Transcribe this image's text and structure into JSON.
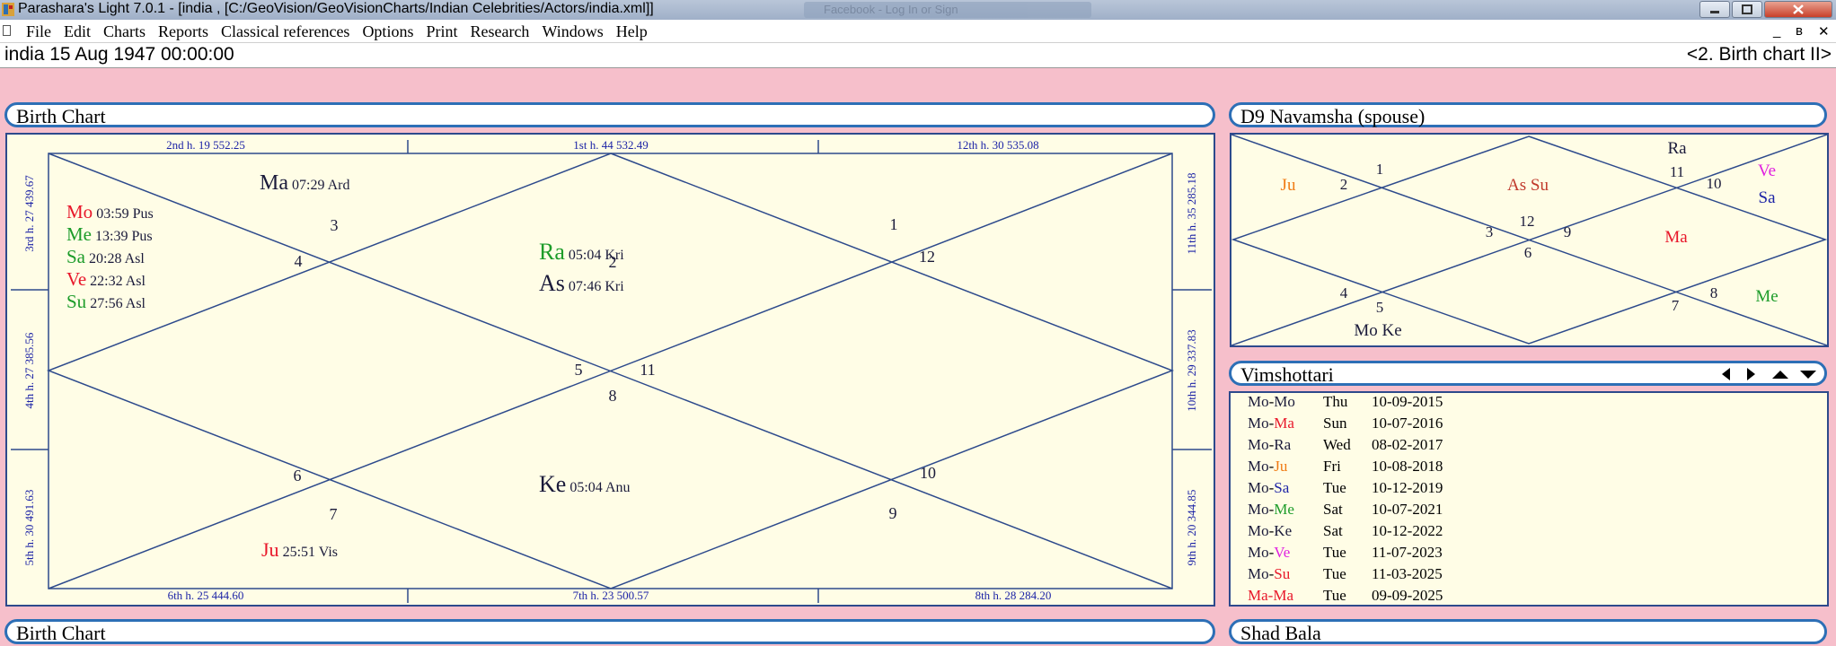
{
  "window": {
    "title": "Parashara's Light 7.0.1 - [india ,  [C:/GeoVision/GeoVisionCharts/Indian Celebrities/Actors/india.xml]]",
    "background_tab": "Facebook - Log In or Sign"
  },
  "menu": [
    "File",
    "Edit",
    "Charts",
    "Reports",
    "Classical references",
    "Options",
    "Print",
    "Research",
    "Windows",
    "Help"
  ],
  "mdi_controls": {
    "minimize": "_",
    "restore": "ʙ",
    "close": "✕"
  },
  "infobar": {
    "left": "india   15 Aug 1947 00:00:00",
    "right": "<2. Birth chart II>"
  },
  "panels": {
    "birth_chart_title": "Birth Chart",
    "d9_title": "D9 Navamsha  (spouse)",
    "vimshottari_title": "Vimshottari",
    "bottom_left_title": "Birth Chart",
    "bottom_right_title": "Shad Bala"
  },
  "colors": {
    "accent": "#2d6fb6",
    "chart_line": "#2d4a8c",
    "chart_bg": "#fffde6",
    "red": "#e8172a",
    "green": "#1d9c2a",
    "blue": "#1c23a6",
    "orange": "#f07a12",
    "magenta": "#e020e0",
    "dark": "#1a1a3a"
  },
  "birth_chart": {
    "houses_top": [
      "2nd h.  19  552.25",
      "1st h.  44  532.49",
      "12th h.  30  535.08"
    ],
    "houses_bottom": [
      "6th h.  25  444.60",
      "7th h.  23  500.57",
      "8th h.  28  284.20"
    ],
    "houses_left": [
      "3rd h.  27  439.67",
      "4th h.  27  385.56",
      "5th h.  30  491.63"
    ],
    "houses_right": [
      "11th h.  35  285.18",
      "10th h.  29  337.83",
      "9th h.  20  344.85"
    ],
    "sign_numbers": {
      "h1": "2",
      "h2": "1",
      "h3": "12",
      "h4": "11",
      "h5": "10",
      "h6": "9",
      "h7": "8",
      "h8": "7",
      "h9": "6",
      "h10": "5",
      "h11": "4",
      "h12": "3"
    },
    "planets": [
      {
        "planet": "Ma",
        "deg": "07:29",
        "nak": "Ard",
        "color": "dark"
      },
      {
        "planet": "Mo",
        "deg": "03:59",
        "nak": "Pus",
        "color": "red"
      },
      {
        "planet": "Me",
        "deg": "13:39",
        "nak": "Pus",
        "color": "green"
      },
      {
        "planet": "Sa",
        "deg": "20:28",
        "nak": "Asl",
        "color": "green"
      },
      {
        "planet": "Ve",
        "deg": "22:32",
        "nak": "Asl",
        "color": "red"
      },
      {
        "planet": "Su",
        "deg": "27:56",
        "nak": "Asl",
        "color": "green"
      },
      {
        "planet": "Ra",
        "deg": "05:04",
        "nak": "Kri",
        "color": "green"
      },
      {
        "planet": "As",
        "deg": "07:46",
        "nak": "Kri",
        "color": "dark"
      },
      {
        "planet": "Ke",
        "deg": "05:04",
        "nak": "Anu",
        "color": "dark"
      },
      {
        "planet": "Ju",
        "deg": "25:51",
        "nak": "Vis",
        "color": "red"
      }
    ]
  },
  "d9": {
    "numbers": {
      "n1": "1",
      "n2": "2",
      "n3": "3",
      "n4": "4",
      "n5": "5",
      "n6": "6",
      "n7": "7",
      "n8": "8",
      "n9": "9",
      "n10": "10",
      "n11": "11",
      "n12": "12"
    },
    "planets": {
      "ju": "Ju",
      "as_su": "As Su",
      "ra": "Ra",
      "ve": "Ve",
      "sa": "Sa",
      "ma": "Ma",
      "me": "Me",
      "mo_ke": "Mo Ke"
    }
  },
  "vimshottari": {
    "rows": [
      {
        "a": "Mo",
        "b": "Mo",
        "day": "Thu",
        "date": "10-09-2015",
        "a_color": "dark",
        "b_color": "dark"
      },
      {
        "a": "Mo",
        "b": "Ma",
        "day": "Sun",
        "date": "10-07-2016",
        "a_color": "dark",
        "b_color": "red"
      },
      {
        "a": "Mo",
        "b": "Ra",
        "day": "Wed",
        "date": "08-02-2017",
        "a_color": "dark",
        "b_color": "dark"
      },
      {
        "a": "Mo",
        "b": "Ju",
        "day": "Fri",
        "date": "10-08-2018",
        "a_color": "dark",
        "b_color": "orange"
      },
      {
        "a": "Mo",
        "b": "Sa",
        "day": "Tue",
        "date": "10-12-2019",
        "a_color": "dark",
        "b_color": "blue"
      },
      {
        "a": "Mo",
        "b": "Me",
        "day": "Sat",
        "date": "10-07-2021",
        "a_color": "dark",
        "b_color": "green"
      },
      {
        "a": "Mo",
        "b": "Ke",
        "day": "Sat",
        "date": "10-12-2022",
        "a_color": "dark",
        "b_color": "dark"
      },
      {
        "a": "Mo",
        "b": "Ve",
        "day": "Tue",
        "date": "11-07-2023",
        "a_color": "dark",
        "b_color": "magenta"
      },
      {
        "a": "Mo",
        "b": "Su",
        "day": "Tue",
        "date": "11-03-2025",
        "a_color": "dark",
        "b_color": "red"
      },
      {
        "a": "Ma",
        "b": "Ma",
        "day": "Tue",
        "date": "09-09-2025",
        "a_color": "red",
        "b_color": "red"
      }
    ]
  }
}
